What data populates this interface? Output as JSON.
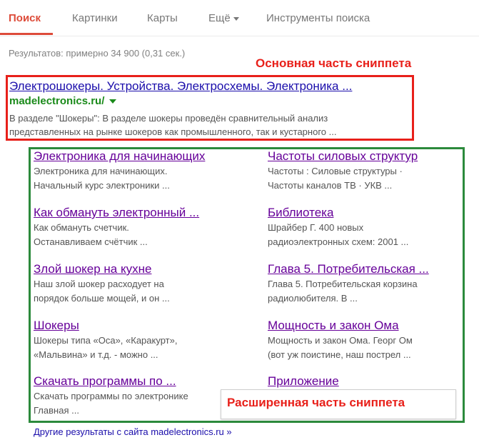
{
  "tabs": [
    {
      "label": "Поиск",
      "active": true
    },
    {
      "label": "Картинки",
      "active": false
    },
    {
      "label": "Карты",
      "active": false
    },
    {
      "label": "Ещё",
      "active": false
    },
    {
      "label": "Инструменты поиска",
      "active": false
    }
  ],
  "stats": "Результатов: примерно 34 900 (0,31 сек.)",
  "annotations": {
    "main_part": "Основная часть сниппета",
    "extended_part": "Расширенная часть сниппета"
  },
  "main_result": {
    "title": "Электрошокеры. Устройства. Электросхемы. Электроника ...",
    "url": "madelectronics.ru/",
    "snippet_lines": [
      "В разделе \"Шокеры\": В разделе шокеры проведён сравнительный анализ",
      "представленных на рынке шокеров как промышленного, так и кустарного ..."
    ]
  },
  "sitelinks": [
    {
      "title": "Электроника для начинающих",
      "lines": [
        "Электроника для начинающих.",
        "Начальный курс электроники ..."
      ]
    },
    {
      "title": "Частоты силовых структур",
      "lines": [
        "Частоты : Силовые структуры ·",
        "Частоты каналов ТВ · УКВ ..."
      ]
    },
    {
      "title": "Как обмануть электронный ...",
      "lines": [
        "Как обмануть счетчик.",
        "Останавливаем счётчик ..."
      ]
    },
    {
      "title": "Библиотека",
      "lines": [
        "Шрайбер Г. 400 новых",
        "радиоэлектронных схем: 2001 ..."
      ]
    },
    {
      "title": "Злой шокер на кухне",
      "lines": [
        "Наш злой шокер расходует на",
        "порядок больше мощей, и он ..."
      ]
    },
    {
      "title": "Глава 5. Потребительская ...",
      "lines": [
        "Глава 5. Потребительская корзина",
        "радиолюбителя. В ..."
      ]
    },
    {
      "title": "Шокеры",
      "lines": [
        "Шокеры типа «Оса», «Каракурт»,",
        "«Мальвина» и т.д. - можно ..."
      ]
    },
    {
      "title": "Мощность и закон Ома",
      "lines": [
        "Мощность и закон Ома. Георг Ом",
        "(вот уж поистине, наш пострел ..."
      ]
    },
    {
      "title": "Скачать программы по ...",
      "lines": [
        "Скачать программы по электронике",
        "Главная ..."
      ]
    },
    {
      "title": "Приложение",
      "lines": []
    }
  ],
  "more_results": "Другие результаты с сайта madelectronics.ru »",
  "colors": {
    "accent_red": "#dd4b39",
    "annotation_red": "#e8201a",
    "annotation_green": "#2c8a3c",
    "link_blue": "#1a0dab",
    "visited_purple": "#660099",
    "url_green": "#1a8a1a"
  }
}
